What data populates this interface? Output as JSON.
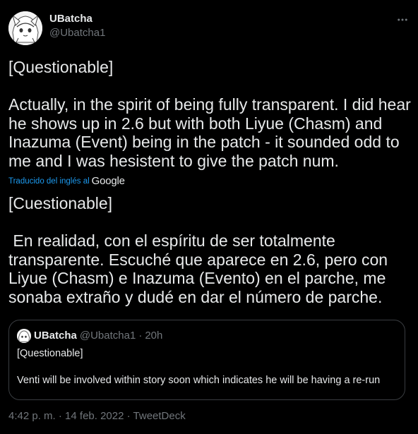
{
  "author": {
    "display_name": "UBatcha",
    "handle": "@Ubatcha1"
  },
  "tweet": {
    "original_text": "[Questionable]\n\nActually, in the spirit of being fully transparent. I did hear he shows up in 2.6 but with both Liyue (Chasm) and Inazuma (Event) being in the patch - it sounded odd to me and I was hesistent to give the patch num.",
    "translated_label": "Traducido del inglés al",
    "translator_name": "Google",
    "translated_text": "[Cuestionable]\n\n En realidad, con el espíritu de ser totalmente transparente. Escuché que aparece en 2.6, pero con Liyue (Chasm) e Inazuma (Evento) en el parche, me sonaba extraño y dudé en dar el número de parche."
  },
  "quoted_tweet": {
    "display_name": "UBatcha",
    "handle": "@Ubatcha1",
    "separator": "·",
    "time": "20h",
    "text": "[Questionable]\n\nVenti will be involved within story soon which indicates he will be having a re-run"
  },
  "footer": {
    "time": "4:42 p. m.",
    "separator": " · ",
    "date": "14 feb. 2022",
    "source": "TweetDeck"
  },
  "icons": {
    "more": "more-horizontal-icon"
  },
  "colors": {
    "background": "#000000",
    "text": "#e7e9ea",
    "secondary": "#71767b",
    "link": "#1d9bf0",
    "border": "#3a3d41"
  }
}
